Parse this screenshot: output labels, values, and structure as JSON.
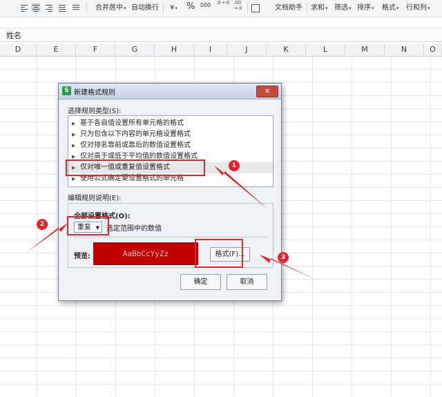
{
  "toolbar": {
    "merge_center": "合并居中",
    "wrap_text": "自动换行",
    "currency": "¥",
    "percent": "%",
    "thousands": "000",
    "inc_decimal": ".0 ←0",
    "dec_decimal": ".00 →.0",
    "doc_helper": "文档助手",
    "sum": "求和",
    "filter": "筛选",
    "sort": "排序",
    "format": "格式",
    "rows_cols": "行和列"
  },
  "namebar": {
    "value": "姓名"
  },
  "columns": [
    "D",
    "E",
    "F",
    "G",
    "H",
    "I",
    "J",
    "K",
    "L",
    "M",
    "N",
    "O"
  ],
  "dialog": {
    "title": "新建格式规则",
    "icon_glyph": "S",
    "close_glyph": "✕",
    "select_rule_type_label": "选择规则类型(S):",
    "rule_types": [
      "基于各自值设置所有单元格的格式",
      "只为包含以下内容的单元格设置格式",
      "仅对排名靠前或靠后的数值设置格式",
      "仅对高于或低于平均值的数值设置格式",
      "仅对唯一值或重复值设置格式",
      "使用公式确定要设置格式的单元格"
    ],
    "selected_rule_index": 4,
    "edit_rule_label": "编辑规则说明(E):",
    "format_all_label": "全部设置格式(O):",
    "dropdown_value": "重复",
    "range_desc": "选定范围中的数值",
    "preview_label": "预览:",
    "preview_text": "AaBbCcYyZz",
    "preview_fill": "#c00000",
    "format_button": "格式(F)...",
    "ok_button": "确定",
    "cancel_button": "取消"
  },
  "annotations": {
    "color": "#e0262a",
    "badges": [
      "1",
      "2",
      "3"
    ]
  }
}
